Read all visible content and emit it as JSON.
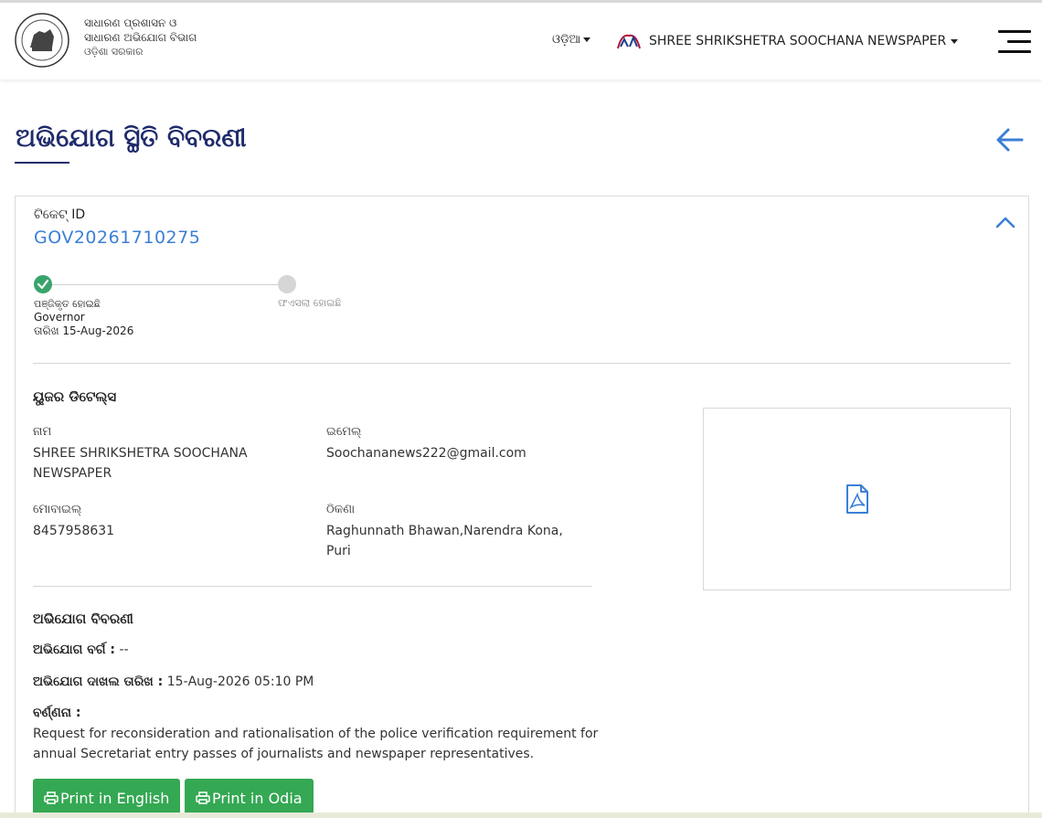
{
  "header": {
    "dept_line1": "ସାଧାରଣ ପ୍ରଶାସନ ଓ",
    "dept_line2": "ସାଧାରଣ ଅଭିଯୋଗ ବିଭାଗ",
    "dept_line3": "ଓଡ଼ିଶା ସରକାର",
    "language": "ଓଡ଼ିଆ",
    "user_name": "SHREE SHRIKSHETRA SOOCHANA NEWSPAPER"
  },
  "page": {
    "title": "ଅଭିଯୋଗ ସ୍ଥିତି ବିବରଣୀ"
  },
  "ticket": {
    "label": "ଟିକେଟ୍ ID",
    "id": "GOV20261710275"
  },
  "progress": {
    "step1_status": "ପଞ୍ଜିକୃତ ହୋଇଛି",
    "step1_officer": "Governor",
    "step1_date": "ତାରିଖ 15-Aug-2026",
    "step2_status": "ଫଏସଲା ହୋଇଛି"
  },
  "user_details": {
    "section_title": "ୟୁଜର ଡିଟେଲ୍ସ",
    "name_label": "ନାମ",
    "name_value": "SHREE SHRIKSHETRA SOOCHANA NEWSPAPER",
    "email_label": "ଇମେଲ୍",
    "email_value": "Soochananews222@gmail.com",
    "mobile_label": "ମୋବାଇଲ୍",
    "mobile_value": "8457958631",
    "address_label": "ଠିକଣା",
    "address_value": "Raghunnath Bhawan,Narendra Kona, Puri"
  },
  "complaint": {
    "section_title": "ଅଭିଯୋଗ ବିବରଣୀ",
    "category_label": "ଅଭିଯୋଗ ବର୍ଗ :",
    "category_value": "--",
    "date_label": "ଅଭିଯୋଗ ଦାଖଲ ତାରିଖ :",
    "date_value": "15-Aug-2026 05:10 PM",
    "description_label": "ବର୍ଣ୍ଣନା :",
    "description_value": "Request for reconsideration and rationalisation of the police verification requirement for annual Secretariat entry passes of journalists and newspaper representatives."
  },
  "buttons": {
    "print_english": "Print in English",
    "print_odia": "Print in Odia"
  },
  "colors": {
    "accent_blue": "#3b7fd6",
    "title_navy": "#1f2b6b",
    "success_green": "#3aa36c",
    "button_green": "#34a853"
  },
  "icons": [
    "odisha-emblem-icon",
    "chevron-down-icon",
    "user-logo-icon",
    "hamburger-menu-icon",
    "back-arrow-icon",
    "chevron-up-icon",
    "check-icon",
    "pdf-file-icon",
    "printer-icon"
  ]
}
